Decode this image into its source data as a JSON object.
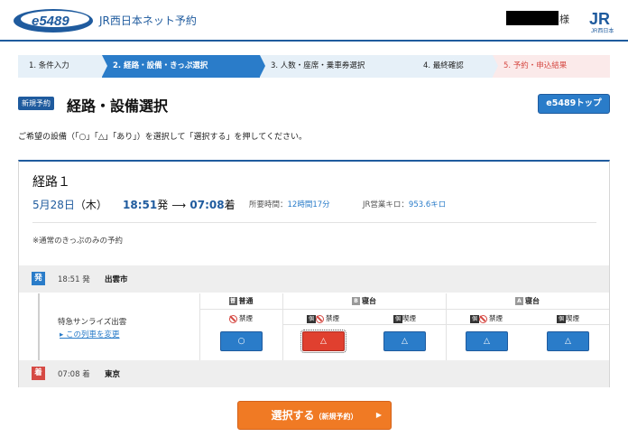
{
  "header": {
    "logo_text": "e5489",
    "brand_title": "JR西日本ネット予約",
    "user_suffix": "様",
    "jr_logo_text": "JR",
    "jr_logo_sub": "JR西日本"
  },
  "steps": [
    {
      "label": "1. 条件入力"
    },
    {
      "label": "2. 経路・設備・きっぷ選択"
    },
    {
      "label": "3. 人数・座席・乗車券選択"
    },
    {
      "label": "4. 最終確認"
    },
    {
      "label": "5. 予約・申込結果"
    }
  ],
  "page": {
    "new_badge": "新規予約",
    "title": "経路・設備選択",
    "top_button": "e5489トップ",
    "instructions": "ご希望の設備（「○」「△」「あり」）を選択して「選択する」を押してください。"
  },
  "route": {
    "title": "経路１",
    "date_main": "5月28日",
    "date_weekday": "（木）",
    "dep_time": "18:51",
    "dep_suffix": "発",
    "arrow": "⟶",
    "arr_time": "07:08",
    "arr_suffix": "着",
    "duration_label": "所要時間：",
    "duration_value": "12時間17分",
    "km_label": "JR営業キロ：",
    "km_value": "953.6キロ",
    "note": "※通常のきっぷのみの予約",
    "departure": {
      "badge": "発",
      "time": "18:51 発",
      "station": "出雲市"
    },
    "arrival": {
      "badge": "着",
      "time": "07:08 着",
      "station": "東京"
    },
    "train_name": "特急サンライズ出雲",
    "change_link": "▸ この列車を変更"
  },
  "facilities": {
    "categories": [
      {
        "icon": "普",
        "label": "普通"
      },
      {
        "icon": "B",
        "label": "寝台"
      },
      {
        "icon": "A",
        "label": "寝台"
      }
    ],
    "sub_labels": [
      "禁煙",
      "禁煙",
      "喫煙",
      "禁煙",
      "喫煙"
    ],
    "room_icon": "個",
    "picks": [
      "○",
      "△",
      "△",
      "△",
      "△"
    ],
    "selected_index": 1
  },
  "footer": {
    "select_label": "選択する",
    "select_sub": "（新規予約）",
    "select_chevron": "▶"
  },
  "colors": {
    "primary": "#2a7cc9",
    "navy": "#1f5b9e",
    "accent_red": "#d64a44",
    "orange": "#f07a24"
  }
}
